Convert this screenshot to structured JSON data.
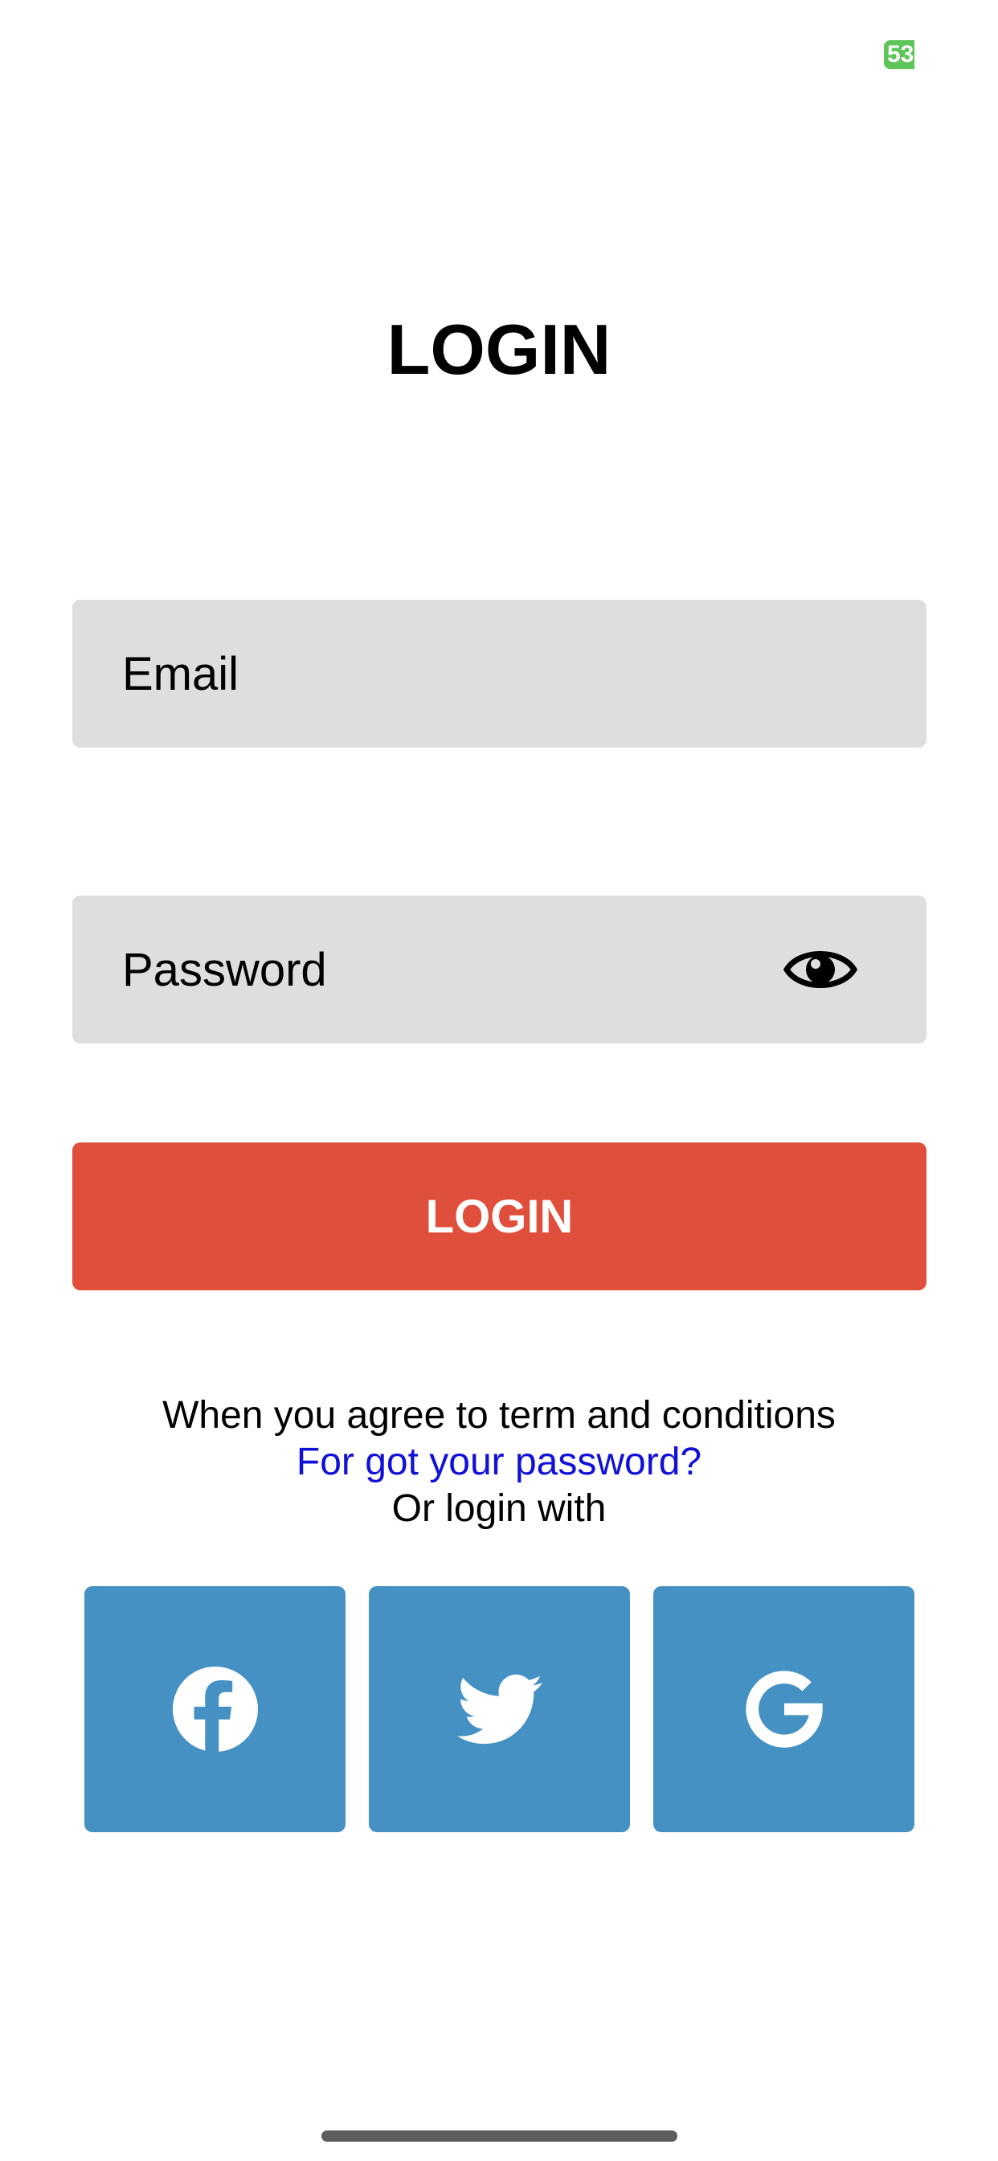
{
  "status_bar": {
    "battery_level": "53"
  },
  "header": {
    "title": "LOGIN"
  },
  "form": {
    "email_placeholder": "Email",
    "password_placeholder": "Password",
    "password_toggle_icon": "eye-icon",
    "login_button_label": "LOGIN"
  },
  "footer": {
    "terms_text": "When you agree to term and conditions",
    "forgot_password_link": "For got your password?",
    "login_with_text": "Or login with"
  },
  "social_logins": [
    {
      "name": "facebook",
      "icon": "facebook-icon"
    },
    {
      "name": "twitter",
      "icon": "twitter-icon"
    },
    {
      "name": "google",
      "icon": "google-icon"
    }
  ],
  "colors": {
    "login_button": "#e04f3b",
    "input_background": "#dedede",
    "social_button": "#4591c3",
    "link": "#1010d8",
    "battery": "#5ec55a"
  }
}
